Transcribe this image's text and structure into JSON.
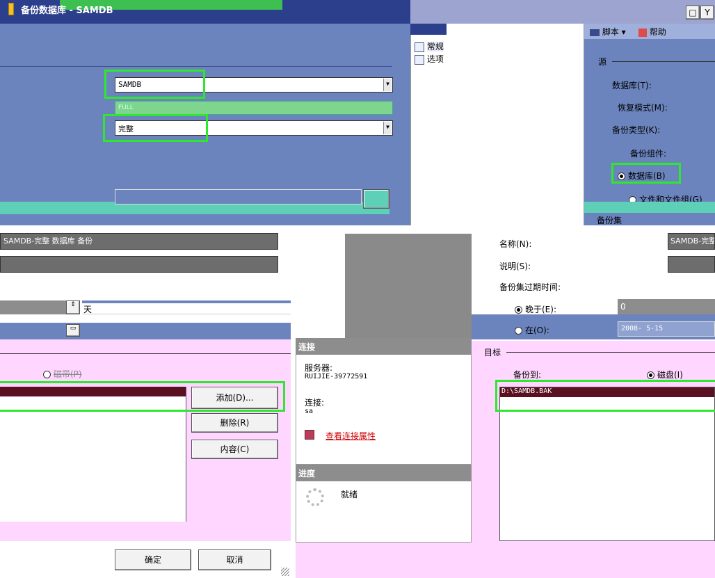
{
  "window": {
    "title": "备份数据库 - SAMDB",
    "controls": [
      "□",
      "Y"
    ]
  },
  "toolbar": {
    "script_label": "脚本",
    "help_label": "帮助"
  },
  "nav": {
    "items": [
      "常规",
      "选项"
    ]
  },
  "source": {
    "section_label": "源",
    "database_label": "数据库(T):",
    "database_value": "SAMDB",
    "recovery_label": "恢复模式(M):",
    "recovery_value": "FULL",
    "backup_type_label": "备份类型(K):",
    "backup_type_value": "完整",
    "component_label": "备份组件:",
    "opt_database": "数据库(B)",
    "opt_files": "文件和文件组(G)"
  },
  "backup_set": {
    "section_label": "备份集",
    "name_label": "名称(N):",
    "name_value": "SAMDB-完整 数据库 备份",
    "desc_label": "说明(S):",
    "expire_label": "备份集过期时间:",
    "after_label": "晚于(E):",
    "after_value": "0",
    "days_label": "天",
    "on_label": "在(O):",
    "on_value": "2008- 5-15"
  },
  "destination": {
    "section_label": "目标",
    "backup_to_label": "备份到:",
    "opt_disk": "磁盘(I)",
    "opt_tape": "磁带(P)",
    "path": "D:\\SAMDB.BAK"
  },
  "buttons": {
    "add": "添加(D)...",
    "remove": "删除(R)",
    "contents": "内容(C)",
    "ok": "确定",
    "cancel": "取消"
  },
  "connection": {
    "header": "连接",
    "server_label": "服务器:",
    "server_value": "RUIJIE-39772591",
    "conn_label": "连接:",
    "conn_value": "sa",
    "link_label": "查看连接属性"
  },
  "progress": {
    "header": "进度",
    "status": "就绪"
  },
  "colors": {
    "blue": "#6b84bd",
    "pink": "#ffd6ff",
    "green_hl": "#2ee82e",
    "teal": "#5fd0b8",
    "maroon": "#5a1020"
  }
}
